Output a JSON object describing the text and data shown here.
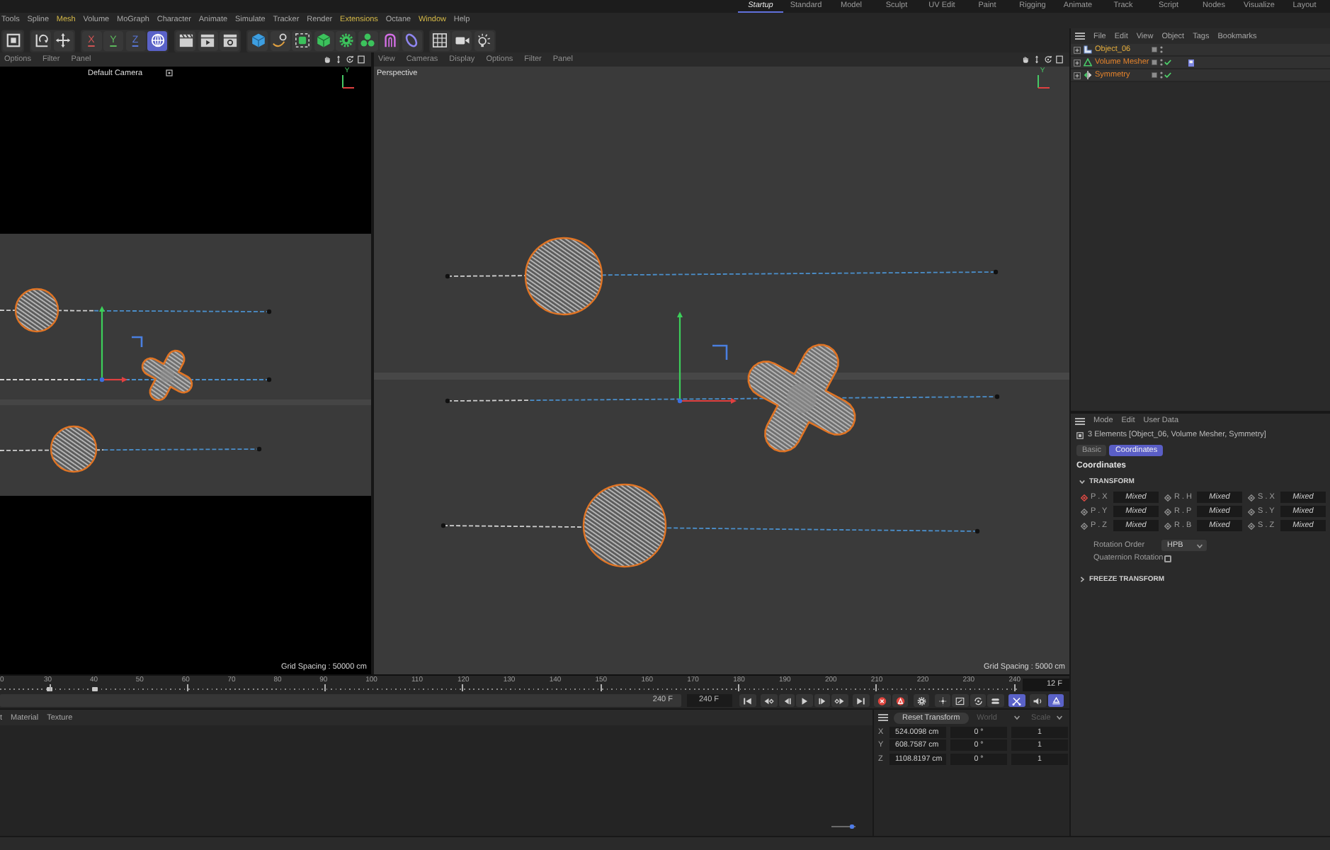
{
  "layout_tabs": [
    {
      "label": "Startup",
      "selected": true
    },
    {
      "label": "Standard",
      "selected": false
    },
    {
      "label": "Model",
      "selected": false
    },
    {
      "label": "Sculpt",
      "selected": false
    },
    {
      "label": "UV Edit",
      "selected": false
    },
    {
      "label": "Paint",
      "selected": false
    },
    {
      "label": "Rigging",
      "selected": false
    },
    {
      "label": "Animate",
      "selected": false
    },
    {
      "label": "Track",
      "selected": false
    },
    {
      "label": "Script",
      "selected": false
    },
    {
      "label": "Nodes",
      "selected": false
    },
    {
      "label": "Visualize",
      "selected": false
    },
    {
      "label": "Layout",
      "selected": false
    }
  ],
  "menu_bar": [
    {
      "label": "Tools",
      "highlighted": false
    },
    {
      "label": "Spline",
      "highlighted": false
    },
    {
      "label": "Mesh",
      "highlighted": true
    },
    {
      "label": "Volume",
      "highlighted": false
    },
    {
      "label": "MoGraph",
      "highlighted": false
    },
    {
      "label": "Character",
      "highlighted": false
    },
    {
      "label": "Animate",
      "highlighted": false
    },
    {
      "label": "Simulate",
      "highlighted": false
    },
    {
      "label": "Tracker",
      "highlighted": false
    },
    {
      "label": "Render",
      "highlighted": false
    },
    {
      "label": "Extensions",
      "highlighted": true
    },
    {
      "label": "Octane",
      "highlighted": false
    },
    {
      "label": "Window",
      "highlighted": true
    },
    {
      "label": "Help",
      "highlighted": false
    }
  ],
  "toolbar": {
    "groups": [
      {
        "items": [
          {
            "kind": "icon",
            "selected": false
          }
        ]
      },
      {
        "items": [
          {
            "kind": "icon",
            "selected": false
          },
          {
            "kind": "icon",
            "selected": false
          }
        ]
      },
      {
        "items": [
          {
            "kind": "axis",
            "label": "X",
            "color": "#d05454"
          },
          {
            "kind": "axis",
            "label": "Y",
            "color": "#5cb85c"
          },
          {
            "kind": "axis",
            "label": "Z",
            "color": "#5a78d8"
          },
          {
            "kind": "icon",
            "selected": true
          }
        ]
      },
      {
        "items": [
          {
            "kind": "icon",
            "selected": false
          },
          {
            "kind": "icon",
            "selected": false
          },
          {
            "kind": "icon",
            "selected": false
          }
        ]
      },
      {
        "items": [
          {
            "kind": "icon",
            "selected": false
          },
          {
            "kind": "icon",
            "selected": false
          },
          {
            "kind": "icon",
            "selected": false
          },
          {
            "kind": "icon",
            "selected": false
          },
          {
            "kind": "icon",
            "selected": false
          },
          {
            "kind": "icon",
            "selected": false
          },
          {
            "kind": "icon",
            "selected": false
          },
          {
            "kind": "icon",
            "selected": false
          }
        ]
      },
      {
        "items": [
          {
            "kind": "icon",
            "selected": false
          },
          {
            "kind": "icon",
            "selected": false
          },
          {
            "kind": "icon",
            "selected": false
          }
        ]
      }
    ]
  },
  "viewports": [
    {
      "kind": "camera",
      "menu": [
        "Options",
        "Filter",
        "Panel"
      ],
      "camera": "Default Camera",
      "axis_label": "Y",
      "grid_spacing": "Grid Spacing : 50000 cm"
    },
    {
      "kind": "perspective",
      "menu": [
        "View",
        "Cameras",
        "Display",
        "Options",
        "Filter",
        "Panel"
      ],
      "camera": "Perspective",
      "axis_label": "Y",
      "grid_spacing": "Grid Spacing : 5000 cm"
    }
  ],
  "timeline": {
    "ruler": [
      {
        "label": "0",
        "major": false,
        "key": false
      },
      {
        "label": "30",
        "major": true,
        "key": true
      },
      {
        "label": "40",
        "major": false,
        "key": true
      },
      {
        "label": "50",
        "major": false,
        "key": false
      },
      {
        "label": "60",
        "major": true,
        "key": false
      },
      {
        "label": "70",
        "major": false,
        "key": false
      },
      {
        "label": "80",
        "major": false,
        "key": false
      },
      {
        "label": "90",
        "major": true,
        "key": false
      },
      {
        "label": "100",
        "major": false,
        "key": false
      },
      {
        "label": "110",
        "major": false,
        "key": false
      },
      {
        "label": "120",
        "major": true,
        "key": false
      },
      {
        "label": "130",
        "major": false,
        "key": false
      },
      {
        "label": "140",
        "major": false,
        "key": false
      },
      {
        "label": "150",
        "major": true,
        "key": false
      },
      {
        "label": "160",
        "major": false,
        "key": false
      },
      {
        "label": "170",
        "major": false,
        "key": false
      },
      {
        "label": "180",
        "major": true,
        "key": false
      },
      {
        "label": "190",
        "major": false,
        "key": false
      },
      {
        "label": "200",
        "major": false,
        "key": false
      },
      {
        "label": "210",
        "major": true,
        "key": false
      },
      {
        "label": "220",
        "major": false,
        "key": false
      },
      {
        "label": "230",
        "major": false,
        "key": false
      },
      {
        "label": "240",
        "major": true,
        "key": false
      }
    ],
    "current_frame": "12 F",
    "range_end": "240 F",
    "end_frame": "240 F",
    "button_groups": [
      {
        "buttons": [
          {
            "selected": false
          }
        ]
      },
      {
        "buttons": [
          {
            "selected": false
          },
          {
            "selected": false
          },
          {
            "selected": false
          },
          {
            "selected": false
          },
          {
            "selected": false
          }
        ]
      },
      {
        "buttons": [
          {
            "selected": false
          }
        ]
      },
      {
        "buttons": [
          {
            "selected": false
          },
          {
            "selected": false
          }
        ]
      },
      {
        "buttons": [
          {
            "selected": false
          }
        ]
      },
      {
        "buttons": [
          {
            "selected": false
          },
          {
            "selected": false
          },
          {
            "selected": false
          },
          {
            "selected": false
          }
        ]
      },
      {
        "buttons": [
          {
            "selected": true
          }
        ]
      },
      {
        "buttons": [
          {
            "selected": false
          },
          {
            "selected": true
          }
        ]
      }
    ]
  },
  "material_panel": {
    "menu": [
      "t",
      "Material",
      "Texture"
    ],
    "zoom_slider": {
      "level": 0.85
    }
  },
  "coordinates": {
    "reset_button": "Reset Transform",
    "space": {
      "label": "World",
      "disabled": true
    },
    "mode": {
      "label": "Scale",
      "disabled": true
    },
    "rows": [
      {
        "axis": "X",
        "position": "524.0098 cm",
        "rotation": "0 °",
        "scale": "1"
      },
      {
        "axis": "Y",
        "position": "608.7587 cm",
        "rotation": "0 °",
        "scale": "1"
      },
      {
        "axis": "Z",
        "position": "1108.8197 cm",
        "rotation": "0 °",
        "scale": "1"
      }
    ]
  },
  "object_manager": {
    "menu": [
      "File",
      "Edit",
      "View",
      "Object",
      "Tags",
      "Bookmarks"
    ],
    "objects": [
      {
        "name": "Object_06",
        "kind": "polygon",
        "expanded": false,
        "selected": true,
        "active": true,
        "checkmark": false,
        "tag": false
      },
      {
        "name": "Volume Mesher",
        "kind": "volume",
        "expanded": false,
        "selected": true,
        "active": false,
        "checkmark": true,
        "tag": true
      },
      {
        "name": "Symmetry",
        "kind": "symmetry",
        "expanded": false,
        "selected": true,
        "active": false,
        "checkmark": true,
        "tag": false
      }
    ]
  },
  "attribute_manager": {
    "menu": [
      "Mode",
      "Edit",
      "User Data"
    ],
    "title": "3 Elements [Object_06, Volume Mesher, Symmetry]",
    "tabs": [
      {
        "label": "Basic",
        "selected": false
      },
      {
        "label": "Coordinates",
        "selected": true
      }
    ],
    "section": "Coordinates",
    "groups": [
      {
        "title": "TRANSFORM",
        "expanded": true,
        "fields": [
          [
            {
              "label": "P . X",
              "value": "Mixed",
              "animated": true
            },
            {
              "label": "R . H",
              "value": "Mixed",
              "animated": false
            },
            {
              "label": "S . X",
              "value": "Mixed",
              "animated": false
            }
          ],
          [
            {
              "label": "P . Y",
              "value": "Mixed",
              "animated": false
            },
            {
              "label": "R . P",
              "value": "Mixed",
              "animated": false
            },
            {
              "label": "S . Y",
              "value": "Mixed",
              "animated": false
            }
          ],
          [
            {
              "label": "P . Z",
              "value": "Mixed",
              "animated": false
            },
            {
              "label": "R . B",
              "value": "Mixed",
              "animated": false
            },
            {
              "label": "S . Z",
              "value": "Mixed",
              "animated": false
            }
          ]
        ],
        "rotation_order": {
          "label": "Rotation Order",
          "value": "HPB"
        },
        "quaternion": {
          "label": "Quaternion Rotation",
          "checked": false
        }
      },
      {
        "title": "FREEZE TRANSFORM",
        "expanded": false
      }
    ]
  }
}
